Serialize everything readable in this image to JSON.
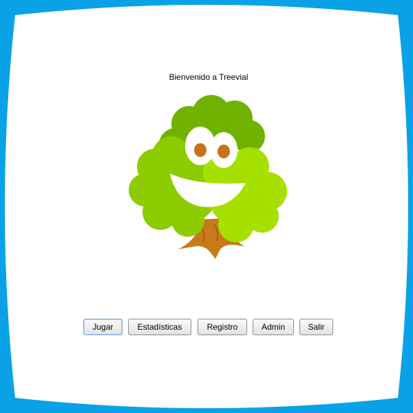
{
  "welcome": {
    "text": "Bienvenido a Treevial"
  },
  "mascot": {
    "icon": "tree-mascot-icon",
    "colors": {
      "foliage_dark": "#6fb300",
      "foliage_mid": "#8dcc00",
      "foliage_light": "#a6e000",
      "trunk": "#c87a1a",
      "eyes": "#ffffff",
      "pupils": "#c8731a"
    }
  },
  "buttons": {
    "play": "Jugar",
    "stats": "Estadísticas",
    "register": "Registro",
    "admin": "Admin",
    "exit": "Salir"
  },
  "colors": {
    "frame_accent": "#0aa2e6",
    "background": "#ffffff"
  }
}
